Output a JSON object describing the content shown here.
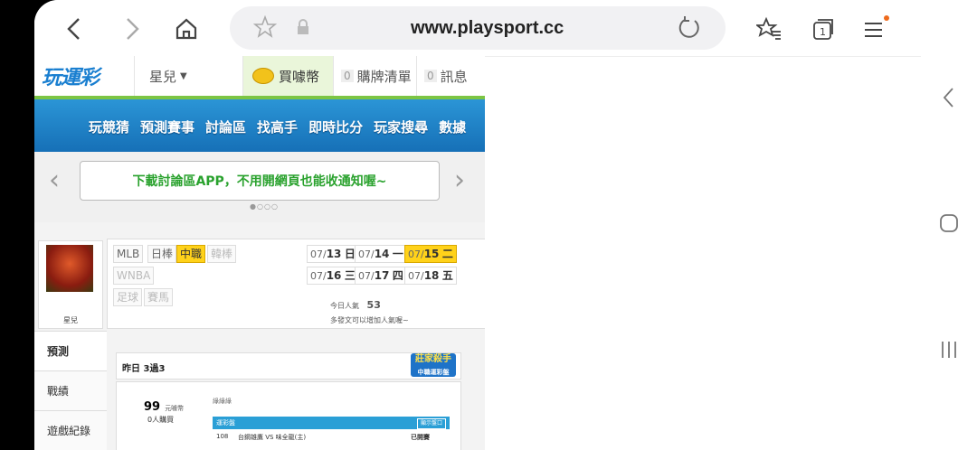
{
  "browser": {
    "url": "www.playsport.cc"
  },
  "site": {
    "logo": "玩運彩",
    "user": "星兒",
    "buy_coin": "買噱幣",
    "cart_count": "0",
    "cart": "購牌清單",
    "msg_count": "0",
    "msg": "訊息",
    "menu": [
      "玩競猜",
      "預測賽事",
      "討論區",
      "找高手",
      "即時比分",
      "玩家搜尋",
      "數據"
    ],
    "banner": "下載討論區APP，不用開網頁也能收通知喔~",
    "dots": "●○○○",
    "avatar_name": "星兒",
    "chips": [
      "MLB",
      "日棒",
      "中職",
      "韓棒",
      "WNBA",
      "足球",
      "賽馬"
    ],
    "dates": [
      {
        "d": "07/",
        "n": "13",
        "w": "日"
      },
      {
        "d": "07/",
        "n": "14",
        "w": "一"
      },
      {
        "d": "07/",
        "n": "15",
        "w": "二"
      },
      {
        "d": "07/",
        "n": "16",
        "w": "三"
      },
      {
        "d": "07/",
        "n": "17",
        "w": "四"
      },
      {
        "d": "07/",
        "n": "18",
        "w": "五"
      }
    ],
    "popularity_label": "今日人氣",
    "popularity_value": "53",
    "popularity_tip": "多發文可以增加人氣喔~",
    "tabs": [
      "預測",
      "戰績",
      "遊戲紀錄"
    ],
    "record": "昨日 3過3",
    "stamp": "莊家殺手",
    "stamp_sub": "中職運彩盤",
    "price": "99",
    "price_unit": "元噱幣",
    "buyers": "0人購買",
    "seller_tag": "綠綠綠",
    "table_title": "運彩盤",
    "table_btn": "顯示盤口",
    "game_no": "108",
    "game_text": "台鋼雄鷹 VS 味全龍(主)",
    "game_status": "已開賽"
  }
}
